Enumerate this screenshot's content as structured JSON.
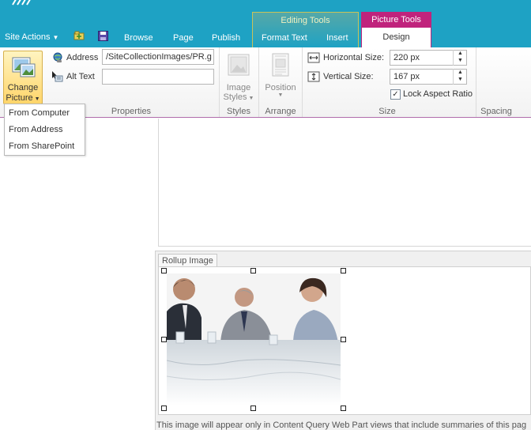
{
  "colors": {
    "teal": "#1ea2c4",
    "picture_tools": "#c0237c",
    "highlight": "#ffd56a"
  },
  "top_nav": {
    "site_actions": "Site Actions",
    "tabs": [
      "Browse",
      "Page",
      "Publish",
      "Format Text",
      "Insert"
    ],
    "editing_tools": "Editing Tools",
    "picture_tools": "Picture Tools",
    "design_tab": "Design"
  },
  "ribbon": {
    "change_picture": {
      "line1": "Change",
      "line2": "Picture"
    },
    "address": {
      "label": "Address",
      "value": "/SiteCollectionImages/PR.g"
    },
    "alt_text": {
      "label": "Alt Text",
      "value": ""
    },
    "image_styles": {
      "line1": "Image",
      "line2": "Styles"
    },
    "position": {
      "label": "Position"
    },
    "horizontal_size": {
      "label": "Horizontal Size:",
      "value": "220 px"
    },
    "vertical_size": {
      "label": "Vertical Size:",
      "value": "167 px"
    },
    "lock_aspect": {
      "label": "Lock Aspect Ratio",
      "checked": true
    },
    "groups": {
      "properties": "Properties",
      "styles": "Styles",
      "arrange": "Arrange",
      "size": "Size",
      "spacing": "Spacing"
    }
  },
  "menu": {
    "items": [
      "From Computer",
      "From Address",
      "From SharePoint"
    ]
  },
  "field": {
    "tab_label": "Rollup Image",
    "note": "This image will appear only in Content Query Web Part views that include summaries of this pag"
  }
}
